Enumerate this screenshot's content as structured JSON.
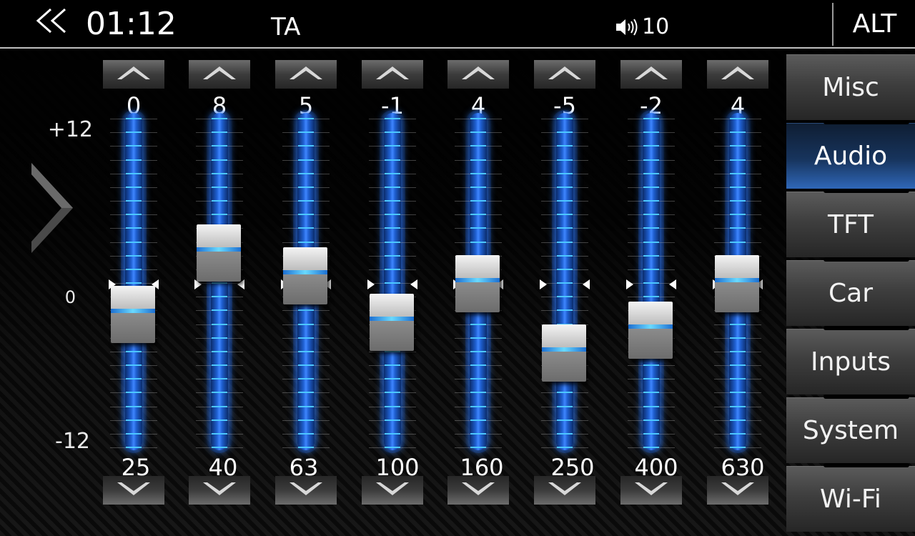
{
  "header": {
    "back_icon": "double-chevron-left-icon",
    "time": "01:12",
    "ta_label": "TA",
    "volume_icon": "speaker-icon",
    "volume_value": "10",
    "alt_label": "ALT"
  },
  "menu": {
    "items": [
      {
        "label": "Misc",
        "active": false
      },
      {
        "label": "Audio",
        "active": true
      },
      {
        "label": "TFT",
        "active": false
      },
      {
        "label": "Car",
        "active": false
      },
      {
        "label": "Inputs",
        "active": false
      },
      {
        "label": "System",
        "active": false
      },
      {
        "label": "Wi-Fi",
        "active": false
      }
    ]
  },
  "equalizer": {
    "scale": {
      "max_label": "+12",
      "zero_label": "0",
      "min_label": "-12",
      "max": 12,
      "min": -12
    },
    "next_icon": "chevron-right-icon",
    "bands": [
      {
        "freq": "25",
        "gain": "0",
        "level": 0
      },
      {
        "freq": "40",
        "gain": "8",
        "level": 8
      },
      {
        "freq": "63",
        "gain": "5",
        "level": 5
      },
      {
        "freq": "100",
        "gain": "-1",
        "level": -1
      },
      {
        "freq": "160",
        "gain": "4",
        "level": 4
      },
      {
        "freq": "250",
        "gain": "-5",
        "level": -5
      },
      {
        "freq": "400",
        "gain": "-2",
        "level": -2
      },
      {
        "freq": "630",
        "gain": "4",
        "level": 4
      }
    ]
  },
  "colors": {
    "accent_blue": "#2f67b8",
    "track_blue": "#3f86ff",
    "menu_gray": "#3e3e3e",
    "header_bg": "#000000"
  }
}
